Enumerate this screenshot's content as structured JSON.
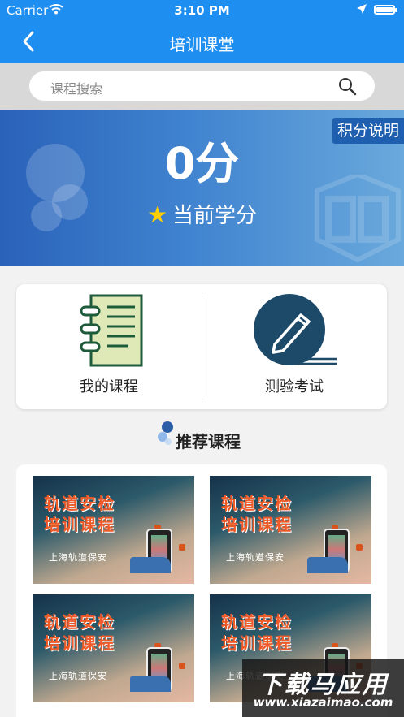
{
  "status_bar": {
    "carrier": "Carrier",
    "time": "3:10 PM"
  },
  "nav": {
    "title": "培训课堂"
  },
  "search": {
    "placeholder": "课程搜索"
  },
  "hero": {
    "score": "0分",
    "label": "当前学分",
    "rules_button": "积分说明"
  },
  "quick_actions": [
    {
      "label": "我的课程",
      "icon": "notebook-icon"
    },
    {
      "label": "测验考试",
      "icon": "pen-icon"
    }
  ],
  "recommended": {
    "title": "推荐课程",
    "courses": [
      {
        "line1": "轨道安检",
        "line2": "培训课程",
        "org": "上海轨道保安"
      },
      {
        "line1": "轨道安检",
        "line2": "培训课程",
        "org": "上海轨道保安"
      },
      {
        "line1": "轨道安检",
        "line2": "培训课程",
        "org": "上海轨道保安"
      },
      {
        "line1": "轨道安检",
        "line2": "培训课程",
        "org": "上海轨道保安"
      }
    ]
  },
  "watermark": {
    "line1": "下载马应用",
    "line2": "www.xiazaimao.com"
  },
  "colors": {
    "primary": "#1f8ef1",
    "accent": "#f05a28",
    "dark_teal": "#1e4a6a"
  }
}
